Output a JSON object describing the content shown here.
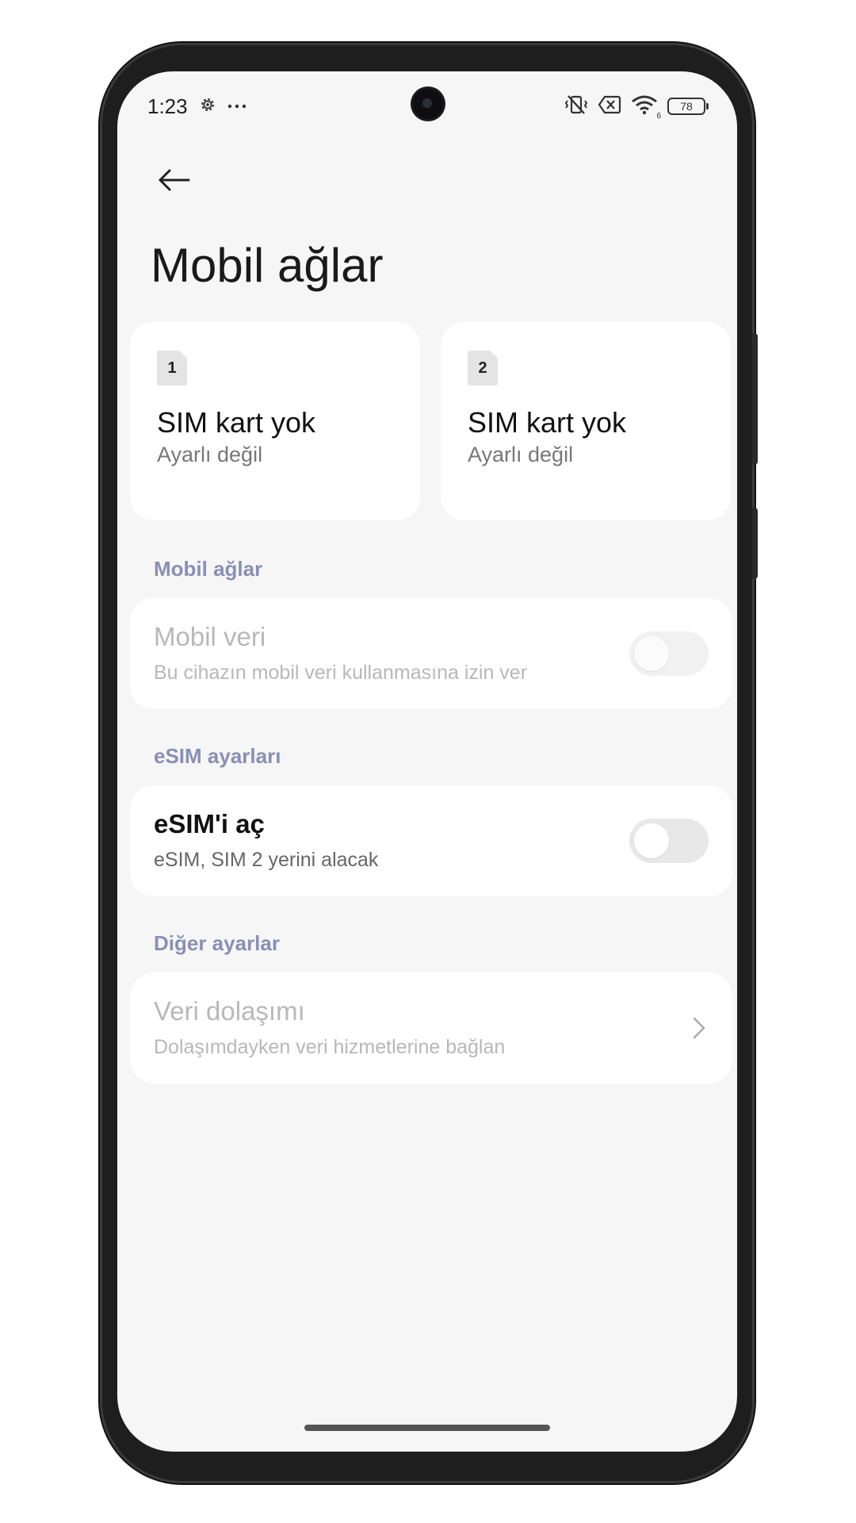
{
  "status_bar": {
    "time": "1:23",
    "left_icons": [
      "gear-icon",
      "more-dots-icon"
    ],
    "right_icons": [
      "vibrate-off-icon",
      "no-sim-icon",
      "wifi-icon"
    ],
    "wifi_badge": "6",
    "battery_level": "78"
  },
  "header": {
    "back_icon": "arrow-left-icon",
    "title": "Mobil ağlar"
  },
  "sim_cards": [
    {
      "slot": "1",
      "title": "SIM kart yok",
      "subtitle": "Ayarlı değil"
    },
    {
      "slot": "2",
      "title": "SIM kart yok",
      "subtitle": "Ayarlı değil"
    }
  ],
  "sections": {
    "mobile_networks": {
      "header": "Mobil ağlar",
      "mobile_data": {
        "title": "Mobil veri",
        "subtitle": "Bu cihazın mobil veri kullanmasına izin ver",
        "enabled": false,
        "on": false
      }
    },
    "esim": {
      "header": "eSIM ayarları",
      "enable_esim": {
        "title": "eSIM'i aç",
        "subtitle": "eSIM, SIM 2 yerini alacak",
        "enabled": true,
        "on": false
      }
    },
    "other": {
      "header": "Diğer ayarlar",
      "roaming": {
        "title": "Veri dolaşımı",
        "subtitle": "Dolaşımdayken veri hizmetlerine bağlan",
        "enabled": false,
        "icon": "chevron-right-icon"
      }
    }
  },
  "colors": {
    "background": "#f6f6f6",
    "card": "#ffffff",
    "section_header": "#8a8fb6",
    "disabled_text": "#b8b8b8",
    "toggle_off": "#e8e8e8"
  }
}
